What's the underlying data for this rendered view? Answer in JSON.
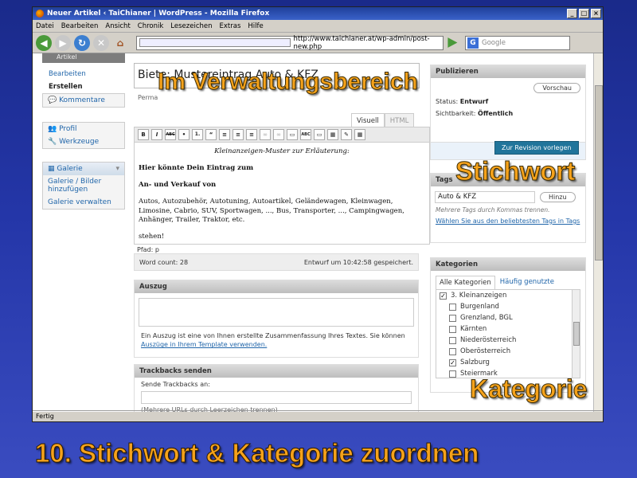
{
  "window": {
    "title": "Neuer Artikel ‹ TaiChianer | WordPress - Mozilla Firefox",
    "menu": [
      "Datei",
      "Bearbeiten",
      "Ansicht",
      "Chronik",
      "Lesezeichen",
      "Extras",
      "Hilfe"
    ],
    "url": "http://www.taichianer.at/wp-admin/post-new.php",
    "search_placeholder": "Google",
    "status": "Fertig"
  },
  "sidebar": {
    "articles_header": "Artikel",
    "articles_sub": [
      "Bearbeiten",
      "Erstellen"
    ],
    "comments": "Kommentare",
    "profile": "Profil",
    "tools": "Werkzeuge",
    "gallery_header": "Galerie",
    "gallery_sub1": "Galerie / Bilder hinzufügen",
    "gallery_sub2": "Galerie verwalten"
  },
  "post": {
    "title": "Biete: Mustereintrag Auto & KFZ",
    "permalink_label": "Perma",
    "tab_visual": "Visuell",
    "tab_html": "HTML",
    "content": {
      "note": "Kleinanzeigen-Muster zur Erläuterung:",
      "heading": "Hier könnte Dein Eintrag zum",
      "subheading": "An- und Verkauf von",
      "body": "Autos, Autozubehör, Autotuning, Autoartikel, Geländewagen, Kleinwagen, Limosine, Cabrio, SUV, Sportwagen, ..., Bus, Transporter, ..., Campingwagen, Anhänger, Trailer, Traktor, etc.",
      "closing": "stehen!"
    },
    "path": "Pfad: p",
    "word_count": "Word count: 28",
    "draft_saved": "Entwurf um 10:42:58 gespeichert."
  },
  "toolbar_buttons": [
    "B",
    "I",
    "ABC",
    "•",
    "1.",
    "“",
    "≡",
    "≡",
    "≡",
    "∞",
    "∞",
    "▭",
    "ABC",
    "▭",
    "▦",
    "✎",
    "▦"
  ],
  "excerpt": {
    "title": "Auszug",
    "help": "Ein Auszug ist eine von Ihnen erstellte Zusammenfassung Ihres Textes. Sie können",
    "help_link": "Auszüge in Ihrem Template verwenden."
  },
  "trackbacks": {
    "title": "Trackbacks senden",
    "label": "Sende Trackbacks an:",
    "hint": "(Mehrere URLs durch Leerzeichen trennen)"
  },
  "publish": {
    "title": "Publizieren",
    "preview": "Vorschau",
    "status_label": "Status:",
    "status_value": "Entwurf",
    "visibility_label": "Sichtbarkeit:",
    "visibility_value": "Öffentlich",
    "submit": "Zur Revision vorlegen"
  },
  "tags": {
    "title": "Tags",
    "input_value": "Auto & KFZ",
    "add": "Hinzu",
    "hint": "Mehrere Tags durch Kommas trennen.",
    "choose_link": "Wählen Sie aus den beliebtesten Tags in Tags"
  },
  "categories": {
    "title": "Kategorien",
    "tab_all": "Alle Kategorien",
    "tab_popular": "Häufig genutzte",
    "items": [
      {
        "name": "3. Kleinanzeigen",
        "checked": true,
        "indent": 0
      },
      {
        "name": "Burgenland",
        "checked": false,
        "indent": 1
      },
      {
        "name": "Grenzland, BGL",
        "checked": false,
        "indent": 1
      },
      {
        "name": "Kärnten",
        "checked": false,
        "indent": 1
      },
      {
        "name": "Niederösterreich",
        "checked": false,
        "indent": 1
      },
      {
        "name": "Oberösterreich",
        "checked": false,
        "indent": 1
      },
      {
        "name": "Salzburg",
        "checked": true,
        "indent": 1
      },
      {
        "name": "Steiermark",
        "checked": false,
        "indent": 1
      }
    ]
  },
  "captions": {
    "admin": "Im Verwaltungsbereich",
    "tag": "Stichwort",
    "category": "Kategorie",
    "slide_title": "10. Stichwort & Kategorie zuordnen"
  },
  "colors": {
    "caption": "#f5a21b",
    "background": "#2436a8",
    "wp_blue": "#21759b"
  }
}
